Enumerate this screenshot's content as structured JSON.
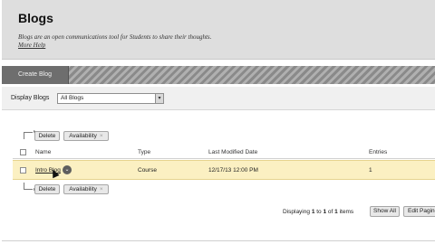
{
  "header": {
    "title": "Blogs",
    "description": "Blogs are an open communications tool for Students to share their thoughts.",
    "more_help": "More Help"
  },
  "action_bar": {
    "create_label": "Create Blog"
  },
  "filter": {
    "label": "Display Blogs",
    "selected": "All Blogs"
  },
  "toolbar": {
    "delete_label": "Delete",
    "availability_label": "Availability"
  },
  "table": {
    "columns": [
      "Name",
      "Type",
      "Last Modified Date",
      "Entries"
    ],
    "rows": [
      {
        "name": "Intro Blog",
        "type": "Course",
        "modified": "12/17/13 12:00 PM",
        "entries": "1"
      }
    ]
  },
  "pagination": {
    "prefix": "Displaying",
    "start": "1",
    "to": "to",
    "end": "1",
    "of": "of",
    "total": "1",
    "suffix": "items",
    "show_all": "Show All",
    "edit_paging": "Edit Paging"
  },
  "colors": {
    "selected_row": "#fbf0c2",
    "action_bar": "#6e6e6e"
  },
  "icons": {
    "row_menu": "chevron-down-icon",
    "select_arrow": "chevron-down-icon",
    "cursor": "mouse-pointer-icon"
  }
}
